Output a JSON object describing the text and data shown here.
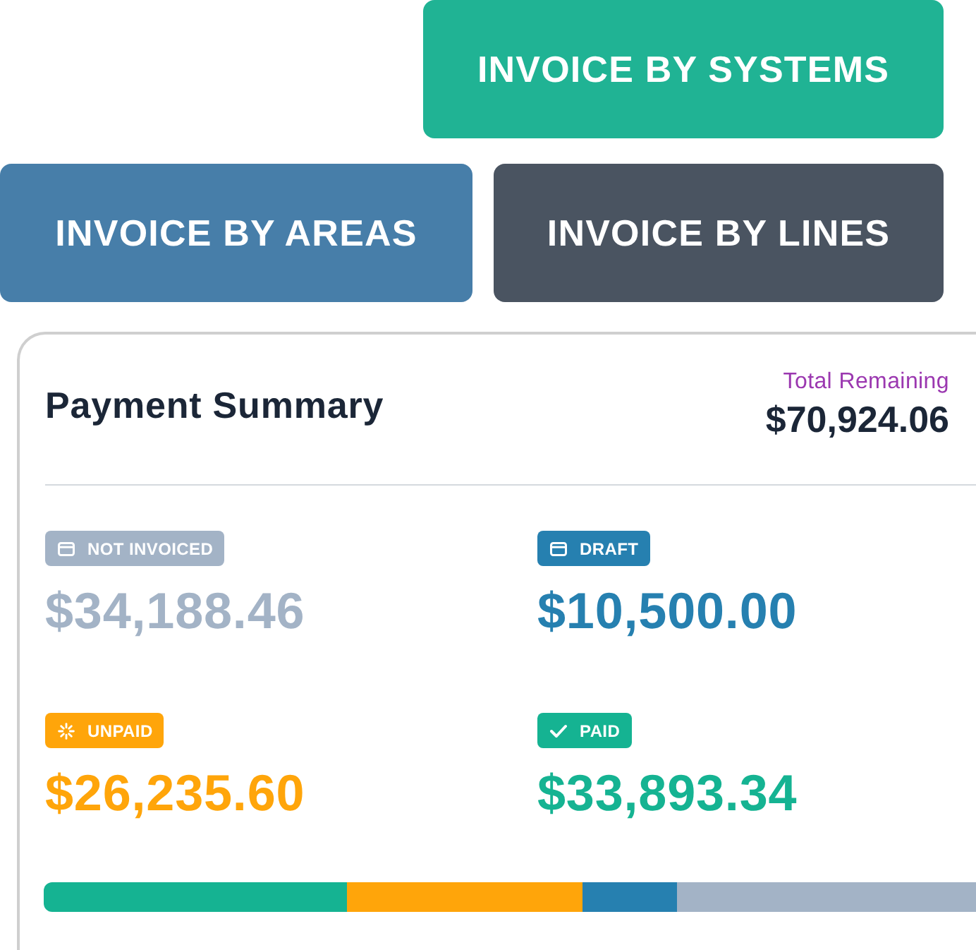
{
  "actions": [
    {
      "label": "INVOICE BY SYSTEMS",
      "color": "#20b394"
    },
    {
      "label": "INVOICE BY AREAS",
      "color": "#477ea9"
    },
    {
      "label": "INVOICE BY LINES",
      "color": "#4a5461"
    }
  ],
  "summary": {
    "title": "Payment Summary",
    "total_label": "Total Remaining",
    "total": "$70,924.06",
    "statuses": [
      {
        "kind": "not_invoiced",
        "label": "NOT INVOICED",
        "amount": "$34,188.46",
        "color": "#a3b3c6"
      },
      {
        "kind": "draft",
        "label": "DRAFT",
        "amount": "$10,500.00",
        "color": "#2680b0"
      },
      {
        "kind": "unpaid",
        "label": "UNPAID",
        "amount": "$26,235.60",
        "color": "#ffa50a"
      },
      {
        "kind": "paid",
        "label": "PAID",
        "amount": "$33,893.34",
        "color": "#15b392"
      }
    ],
    "breakdown_bar": [
      {
        "kind": "paid",
        "color": "#15b392"
      },
      {
        "kind": "unpaid",
        "color": "#ffa50a"
      },
      {
        "kind": "draft",
        "color": "#2680b0"
      },
      {
        "kind": "not_invoiced",
        "color": "#a3b3c6"
      }
    ]
  }
}
